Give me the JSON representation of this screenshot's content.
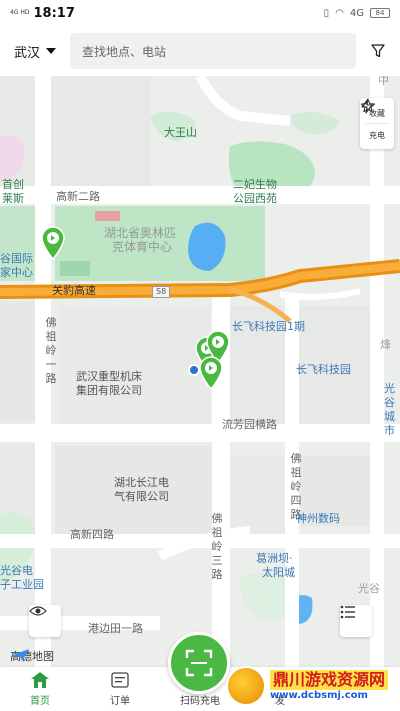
{
  "status_bar": {
    "network": "4G HD",
    "time": "18:17",
    "right_network": "4G",
    "battery": "84"
  },
  "top_bar": {
    "city": "武汉",
    "search_placeholder": "查找地点、电站"
  },
  "side_panel": {
    "favorite_label": "收藏",
    "charge_label": "充电"
  },
  "map": {
    "labels": {
      "dawangshan": "大王山",
      "shouchuang": "首创",
      "laisi": "莱斯",
      "gaoxin2": "高新二路",
      "feizi": "二妃生物",
      "feizi2": "公园西苑",
      "olympic": "湖北省奥林匹",
      "olympic2": "克体育中心",
      "guoji1": "谷国际",
      "guoji2": "家中心",
      "guanbao": "关豹高速",
      "s8": "S8",
      "fozuling1": "佛祖岭一路",
      "changfei1": "长飞科技园1期",
      "changfei": "长飞科技园",
      "zhongxing1": "武汉重型机床",
      "zhongxing2": "集团有限公司",
      "liufang": "流芳园横路",
      "changjiang1": "湖北长江电",
      "changjiang2": "气有限公司",
      "fozuling4": "佛祖岭四路",
      "shenzhou": "神州数码",
      "gaoxin4": "高新四路",
      "guanggu1": "光谷电",
      "guanggu2": "子工业园",
      "fozuling3": "佛祖岭三路",
      "gezhouba1": "葛洲坝·",
      "gezhouba2": "太阳城",
      "gangbian": "港边田一路",
      "guangzhong": "光谷",
      "guangzhong2": "城市",
      "zhong": "中",
      "xi": "烽",
      "guang_right": "光谷"
    }
  },
  "amap_logo_text": "高德地图",
  "bottom_nav": {
    "home": "首页",
    "orders": "订单",
    "scan": "扫码充电",
    "discover": "发"
  },
  "watermark": {
    "title": "鼎川游戏资源网",
    "url": "www.dcbsmj.com"
  },
  "colors": {
    "accent": "#49b943",
    "highway": "#f59a1b",
    "park": "#b9e4c1",
    "water": "#57aef2"
  }
}
